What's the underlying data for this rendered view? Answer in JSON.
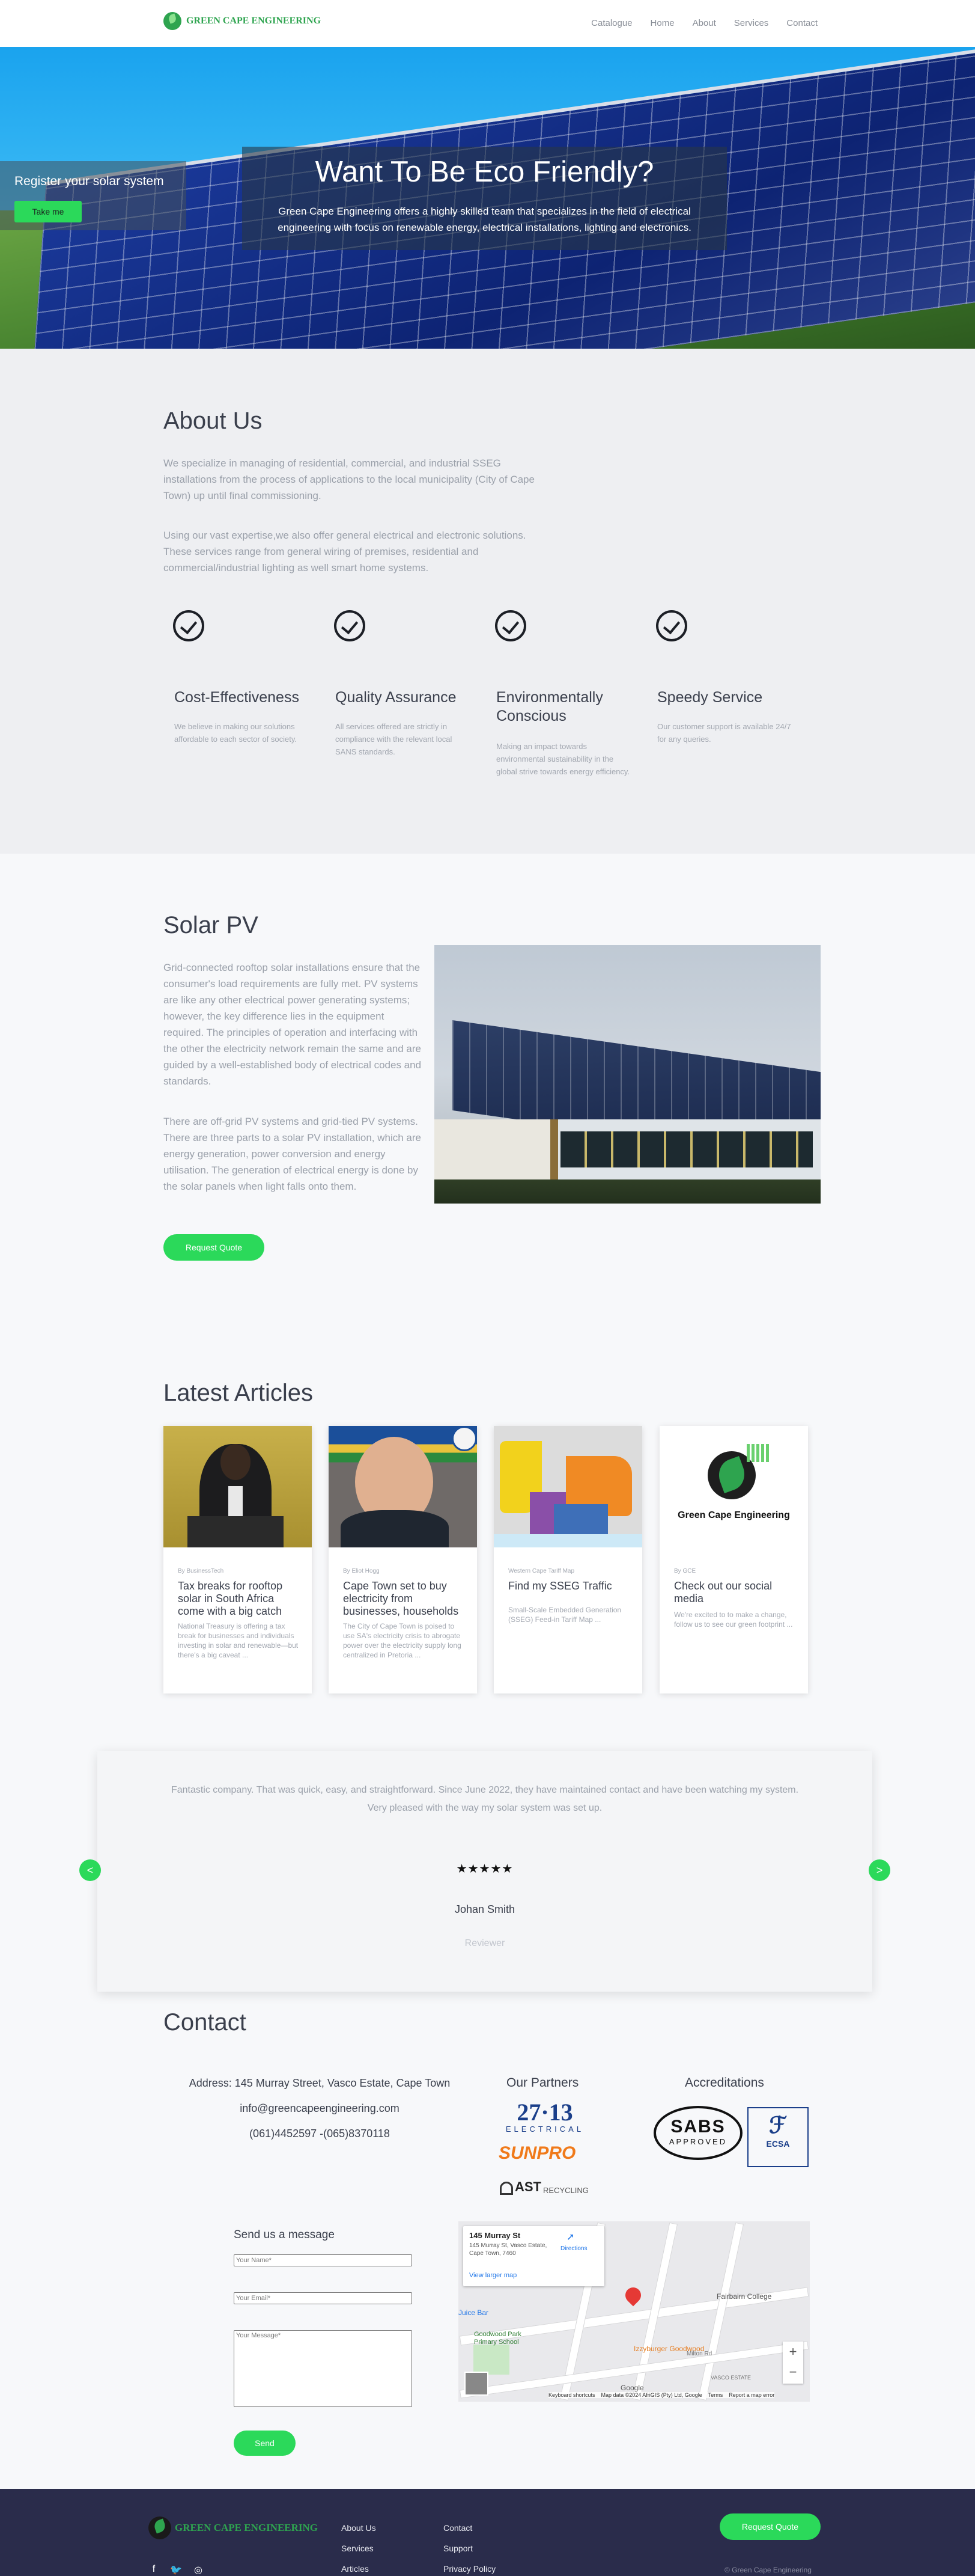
{
  "header": {
    "logo_text": "GREEN CAPE ENGINEERING",
    "nav": [
      "Catalogue",
      "Home",
      "About",
      "Services",
      "Contact"
    ]
  },
  "hero": {
    "register_text": "Register your solar system",
    "register_button": "Take me",
    "title": "Want To Be Eco Friendly?",
    "subtitle": "Green Cape Engineering offers a highly skilled team that specializes in the field of electrical engineering with focus on renewable energy, electrical installations, lighting and electronics."
  },
  "about": {
    "title": "About Us",
    "p1": "We specialize in managing of residential, commercial, and industrial SSEG installations from the process of applications to the local municipality (City of Cape Town) up until final commissioning.",
    "p2": "Using our vast expertise,we also offer general electrical and electronic solutions. These services range from general wiring of premises, residential and commercial/industrial lighting as well smart home systems.",
    "features": [
      {
        "title": "Cost-Effectiveness",
        "text": "We believe in making our solutions affordable to each sector of society."
      },
      {
        "title": "Quality Assurance",
        "text": "All services offered are strictly in compliance with the relevant local SANS standards."
      },
      {
        "title": "Environmentally Conscious",
        "text": "Making an impact towards environmental sustainability in the global strive towards energy efficiency."
      },
      {
        "title": "Speedy Service",
        "text": "Our customer support is available 24/7 for any queries."
      }
    ]
  },
  "solar": {
    "title": "Solar PV",
    "p1": "Grid-connected rooftop solar installations ensure that the consumer's load requirements are fully met. PV systems are like any other electrical power generating systems; however, the key difference lies in the equipment required. The principles of operation and interfacing with the other the electricity network remain the same and are guided by a well-established body of electrical codes and standards.",
    "p2": "There are off-grid PV systems and grid-tied PV systems. There are three parts to a solar PV installation, which are energy generation, power conversion and energy utilisation. The generation of electrical energy is done by the solar panels when light falls onto them.",
    "button": "Request Quote"
  },
  "articles": {
    "title": "Latest Articles",
    "cards": [
      {
        "by": "By BusinessTech",
        "title": "Tax breaks for rooftop solar in South Africa come with a big catch",
        "text": "National Treasury is offering a tax break for businesses and individuals investing in solar and renewable—but there's a big caveat ..."
      },
      {
        "by": "By Eliot Hogg",
        "title": "Cape Town set to buy electricity from businesses, households",
        "text": "The City of Cape Town is poised to use SA's electricity crisis to abrogate power over the electricity supply long centralized in Pretoria ..."
      },
      {
        "by": "Western Cape Tariff Map",
        "title": "Find my SSEG Traffic",
        "text": "Small-Scale Embedded Generation (SSEG) Feed-in Tariff Map ..."
      },
      {
        "by": "By GCE",
        "title": "Check out our social media",
        "text": "We're excited to to make a change, follow us to see our green footprint ..."
      }
    ],
    "card4_logo": "Green Cape Engineering"
  },
  "testimonial": {
    "quote": "Fantastic company. That was quick, easy, and straightforward. Since June 2022, they have maintained contact and have been watching my system. Very pleased with the way my solar system was set up.",
    "stars": "★★★★★",
    "rating": 5,
    "name": "Johan Smith",
    "role": "Reviewer",
    "prev": "<",
    "next": ">"
  },
  "contact": {
    "title": "Contact",
    "address": "Address: 145 Murray Street, Vasco Estate, Cape Town",
    "email": "info@greencapeengineering.com",
    "phone": "(061)4452597 -(065)8370118",
    "partners_title": "Our Partners",
    "partners": [
      "27·13",
      "ELECTRICAL",
      "SUNPRO",
      "AST",
      "RECYCLING"
    ],
    "accreditations_title": "Accreditations",
    "accreditations": [
      "SABS",
      "APPROVED",
      "ECSA"
    ],
    "form_title": "Send us a message",
    "name_placeholder": "Your Name*",
    "email_placeholder": "Your Email*",
    "message_placeholder": "Your Message*",
    "send_button": "Send",
    "map": {
      "place": "145 Murray St",
      "address": "145 Murray St, Vasco Estate, Cape Town, 7460",
      "directions": "Directions",
      "larger": "View larger map",
      "labels": [
        "Juice Bar",
        "Goodwood Park Primary School",
        "Fairbairn College",
        "Izzyburger Goodwood",
        "Milton Rd",
        "VASCO ESTATE",
        "Google"
      ],
      "footer": [
        "Keyboard shortcuts",
        "Map data ©2024 AfriGIS (Pty) Ltd, Google",
        "Terms",
        "Report a map error"
      ]
    }
  },
  "footer": {
    "logo_text": "GREEN CAPE ENGINEERING",
    "col1": [
      "About Us",
      "Services",
      "Articles"
    ],
    "col2": [
      "Contact",
      "Support",
      "Privacy Policy"
    ],
    "button": "Request Quote",
    "copyright": "© Green Cape Engineering"
  },
  "colors": {
    "accent": "#2bd95a",
    "brand": "#2ea44f",
    "footer": "#2a2c4b"
  }
}
